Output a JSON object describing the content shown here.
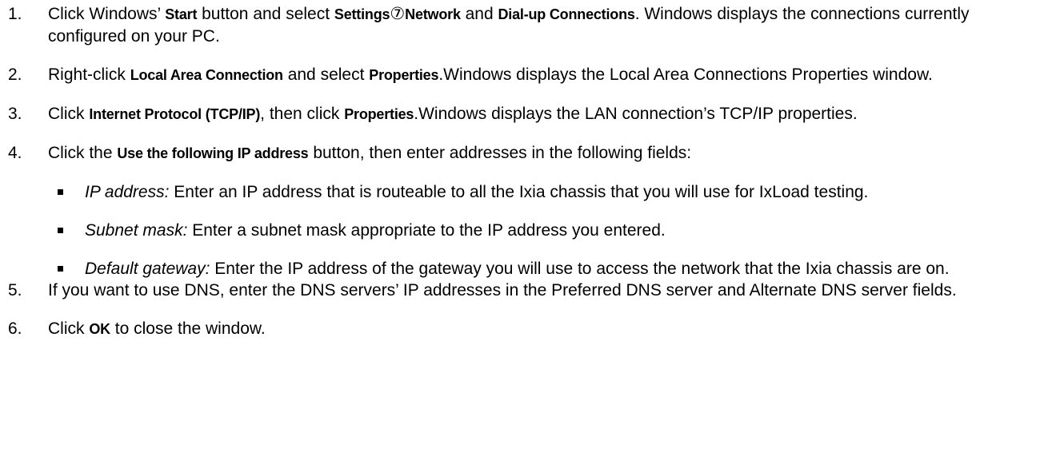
{
  "steps": [
    {
      "num": "1.",
      "t1": "Click Windows’ ",
      "b1": "Start",
      "t2": " button and select ",
      "b2": "Settings",
      "sym": "⑦",
      "b3": "Network",
      "t3": " and ",
      "b4": "Dial-up Connections",
      "t4": ". Windows displays the connections currently configured on your PC."
    },
    {
      "num": "2.",
      "t1": "Right-click ",
      "b1": "Local Area Connection",
      "t2": " and select ",
      "b2": "Properties",
      "t3": ".Windows displays the Local Area Connections Properties window."
    },
    {
      "num": "3.",
      "t1": "Click ",
      "b1": "Internet Protocol (TCP/IP)",
      "t2": ", then click ",
      "b2": "Properties",
      "t3": ".Windows displays the LAN connection’s TCP/IP properties."
    },
    {
      "num": "4.",
      "t1": "Click the ",
      "b1": "Use the following IP address",
      "t2": " button, then enter addresses in the following fields:",
      "bullets": [
        {
          "label": "IP address:",
          "text": " Enter an IP address that is routeable to all the Ixia chassis that you will use for IxLoad testing."
        },
        {
          "label": "Subnet mask:",
          "text": " Enter a subnet mask appropriate to the IP address you entered."
        },
        {
          "label": "Default gateway:",
          "text": " Enter the IP address of the gateway you will use to access the network that the Ixia chassis are on."
        }
      ]
    },
    {
      "num": "5.",
      "t1": "If you want to use DNS, enter the DNS servers’ IP addresses in the Preferred DNS server and Alternate DNS server fields."
    },
    {
      "num": "6.",
      "t1": "Click ",
      "b1": "OK",
      "t2": " to close the window."
    }
  ]
}
